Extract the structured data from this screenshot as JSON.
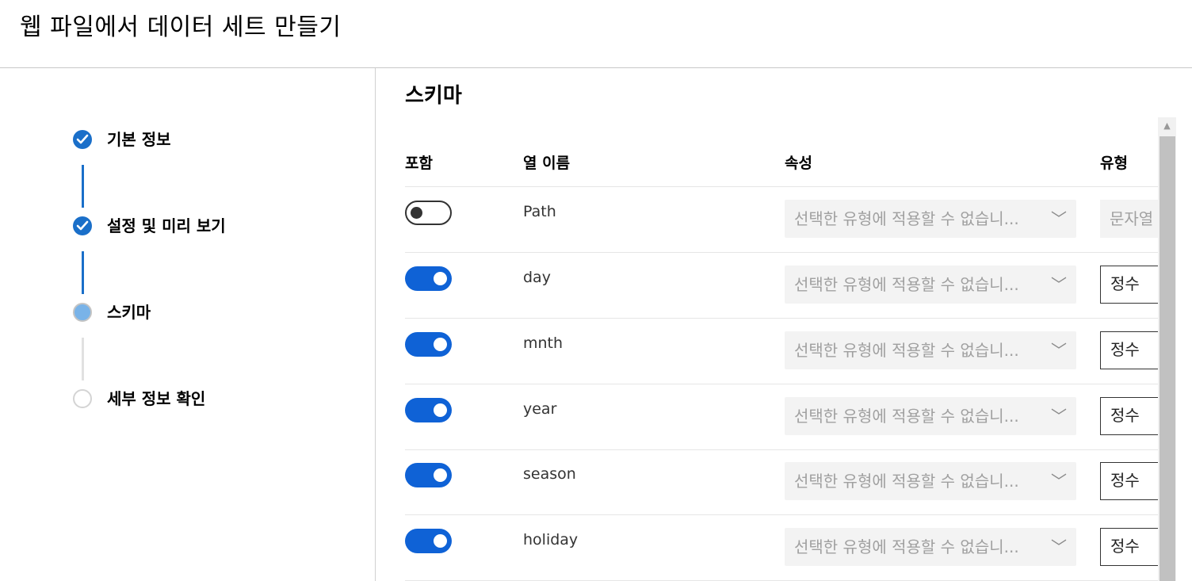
{
  "page": {
    "title": "웹 파일에서 데이터 세트 만들기"
  },
  "steps": [
    {
      "label": "기본 정보",
      "status": "completed"
    },
    {
      "label": "설정 및 미리 보기",
      "status": "completed"
    },
    {
      "label": "스키마",
      "status": "current"
    },
    {
      "label": "세부 정보 확인",
      "status": "pending"
    }
  ],
  "schema": {
    "title": "스키마",
    "columns": {
      "include": "포함",
      "name": "열 이름",
      "property": "속성",
      "type": "유형"
    },
    "rows": [
      {
        "include": false,
        "name": "Path",
        "property": "선택한 유형에 적용할 수 없습니...",
        "type": "문자열"
      },
      {
        "include": true,
        "name": "day",
        "property": "선택한 유형에 적용할 수 없습니...",
        "type": "정수"
      },
      {
        "include": true,
        "name": "mnth",
        "property": "선택한 유형에 적용할 수 없습니...",
        "type": "정수"
      },
      {
        "include": true,
        "name": "year",
        "property": "선택한 유형에 적용할 수 없습니...",
        "type": "정수"
      },
      {
        "include": true,
        "name": "season",
        "property": "선택한 유형에 적용할 수 없습니...",
        "type": "정수"
      },
      {
        "include": true,
        "name": "holiday",
        "property": "선택한 유형에 적용할 수 없습니...",
        "type": "정수"
      }
    ]
  },
  "icons": {
    "dropdown": "chevron-down-icon",
    "completed": "checkmark-icon",
    "scroll_up": "arrow-up-icon"
  },
  "colors": {
    "accent": "#0f62d6",
    "completed_step": "#1a6fc9",
    "current_step": "#79b3e8"
  }
}
